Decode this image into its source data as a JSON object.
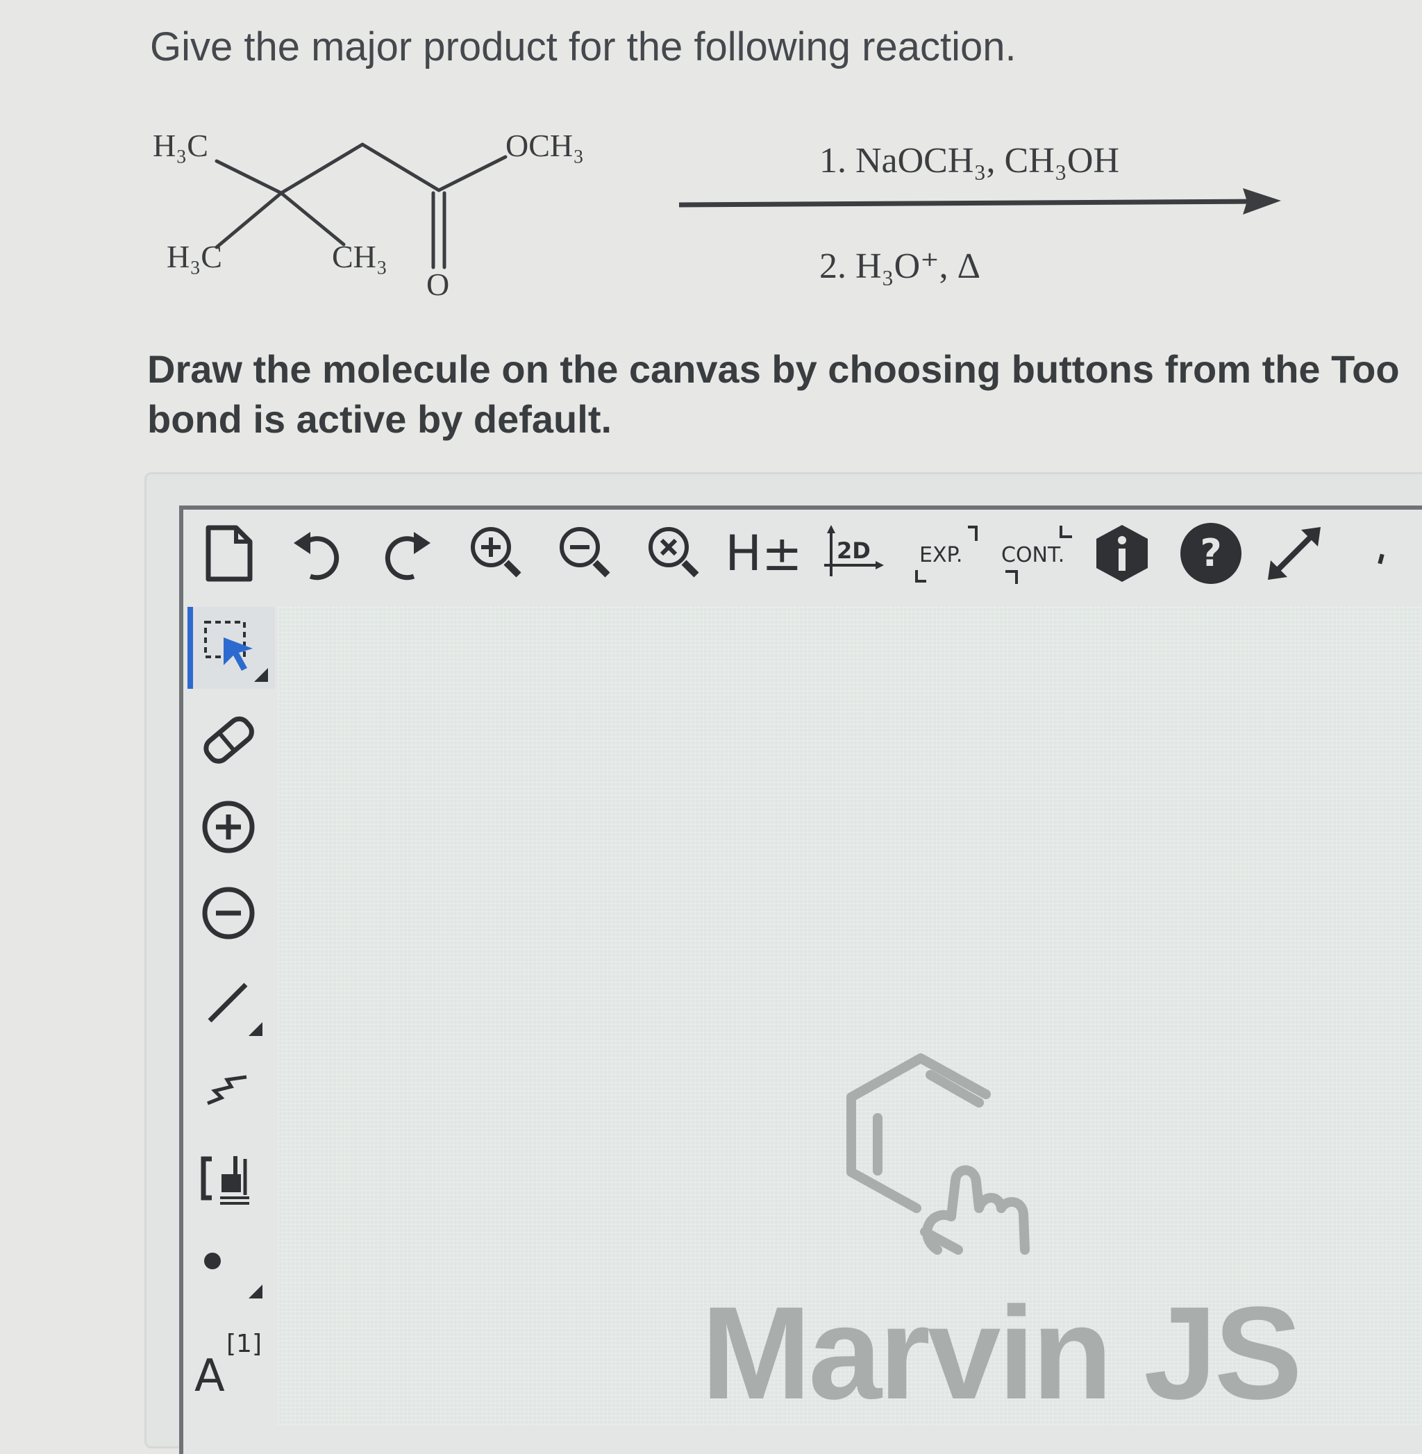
{
  "question": {
    "prompt": "Give the major product for the following reaction."
  },
  "reaction": {
    "labels": {
      "h3c_top": "H₃C",
      "h3c_bottom": "H₃C",
      "ch3": "CH₃",
      "och3": "OCH₃",
      "carbonyl_o": "O"
    },
    "step1": "1. NaOCH₃, CH₃OH",
    "step2": "2. H₃O⁺, Δ"
  },
  "instructions": {
    "line1": "Draw the molecule on the canvas by choosing buttons from the Too",
    "line2": "bond is active by default."
  },
  "toolbar_top": {
    "buttons": [
      {
        "icon": "new-document-icon"
      },
      {
        "icon": "undo-icon"
      },
      {
        "icon": "redo-icon"
      },
      {
        "icon": "zoom-in-icon"
      },
      {
        "icon": "zoom-out-icon"
      },
      {
        "icon": "zoom-fit-icon"
      },
      {
        "icon": "hydrogen-toggle-icon",
        "label": "H±"
      },
      {
        "icon": "clean-2d-icon",
        "label": "2D"
      },
      {
        "icon": "expand-group-icon",
        "label": "EXP."
      },
      {
        "icon": "contract-group-icon",
        "label": "CONT."
      },
      {
        "icon": "info-icon"
      },
      {
        "icon": "help-icon"
      },
      {
        "icon": "fullscreen-icon"
      }
    ]
  },
  "toolbar_left": {
    "tools": [
      {
        "icon": "selection-tool-icon",
        "active": true
      },
      {
        "icon": "eraser-icon"
      },
      {
        "icon": "positive-charge-icon"
      },
      {
        "icon": "negative-charge-icon"
      },
      {
        "icon": "single-bond-icon"
      },
      {
        "icon": "chain-icon"
      },
      {
        "icon": "bracket-icon"
      },
      {
        "icon": "radical-dot-icon"
      },
      {
        "icon": "atom-map-icon",
        "label": "A",
        "sup": "[1]"
      }
    ]
  },
  "canvas": {
    "watermark": "Marvin JS"
  },
  "colors": {
    "accent": "#2d6ad0",
    "icon_dark": "#2f3134",
    "watermark": "#a9adab"
  }
}
